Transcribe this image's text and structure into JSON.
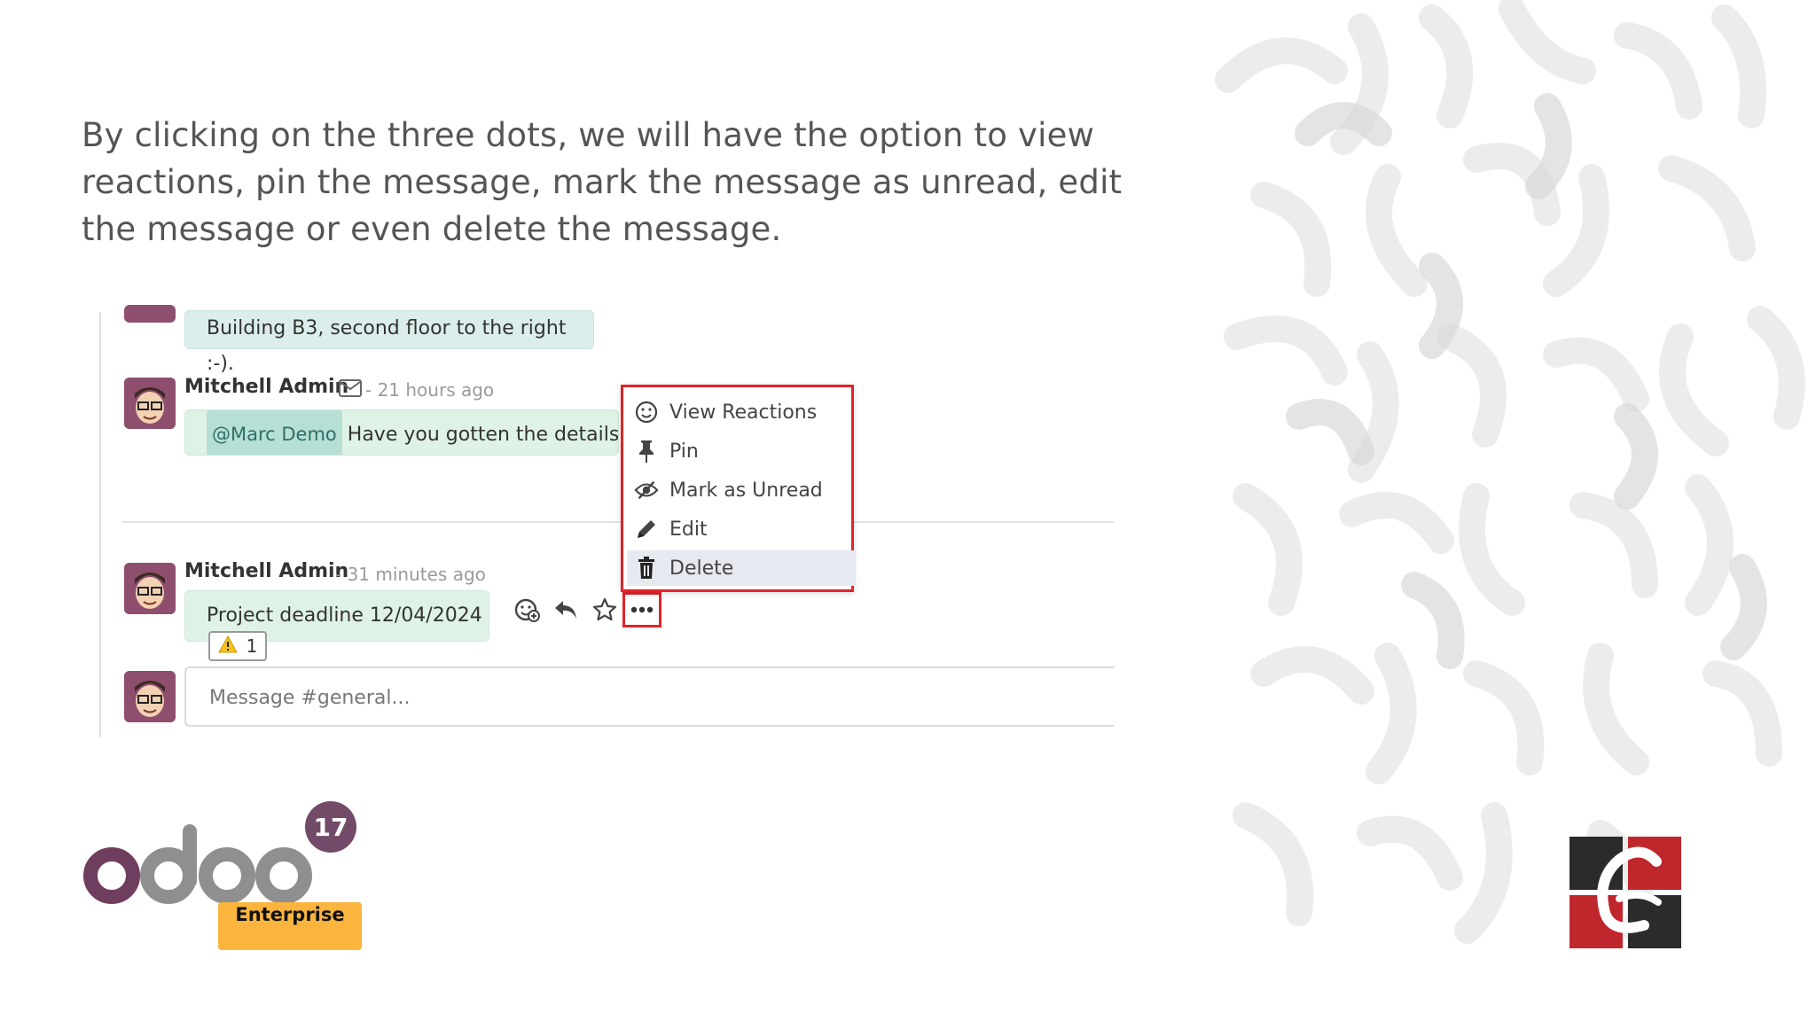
{
  "description": "By clicking on the three dots, we will have the option to view reactions, pin the message, mark the message as unread, edit the message or even delete the message.",
  "chat": {
    "messages": [
      {
        "text": "Building B3, second floor to the right :-)."
      },
      {
        "author": "Mitchell Admin",
        "meta": "- 21 hours ago",
        "mention": "@Marc Demo",
        "text": "Have you gotten the details of"
      },
      {
        "author": "Mitchell Admin",
        "meta": "- 31 minutes ago",
        "text": "Project deadline 12/04/2024",
        "reaction_count": "1"
      }
    ],
    "composer_placeholder": "Message #general..."
  },
  "menu": {
    "items": [
      {
        "label": "View Reactions",
        "icon": "smile-icon"
      },
      {
        "label": "Pin",
        "icon": "pin-icon"
      },
      {
        "label": "Mark as Unread",
        "icon": "eye-slash-icon"
      },
      {
        "label": "Edit",
        "icon": "pencil-icon"
      },
      {
        "label": "Delete",
        "icon": "trash-icon"
      }
    ]
  },
  "branding": {
    "odoo_word": "odoo",
    "version": "17",
    "edition": "Enterprise"
  },
  "colors": {
    "highlight": "#e2232a",
    "odoo_purple": "#714b67",
    "edition_badge": "#fbb53e"
  }
}
